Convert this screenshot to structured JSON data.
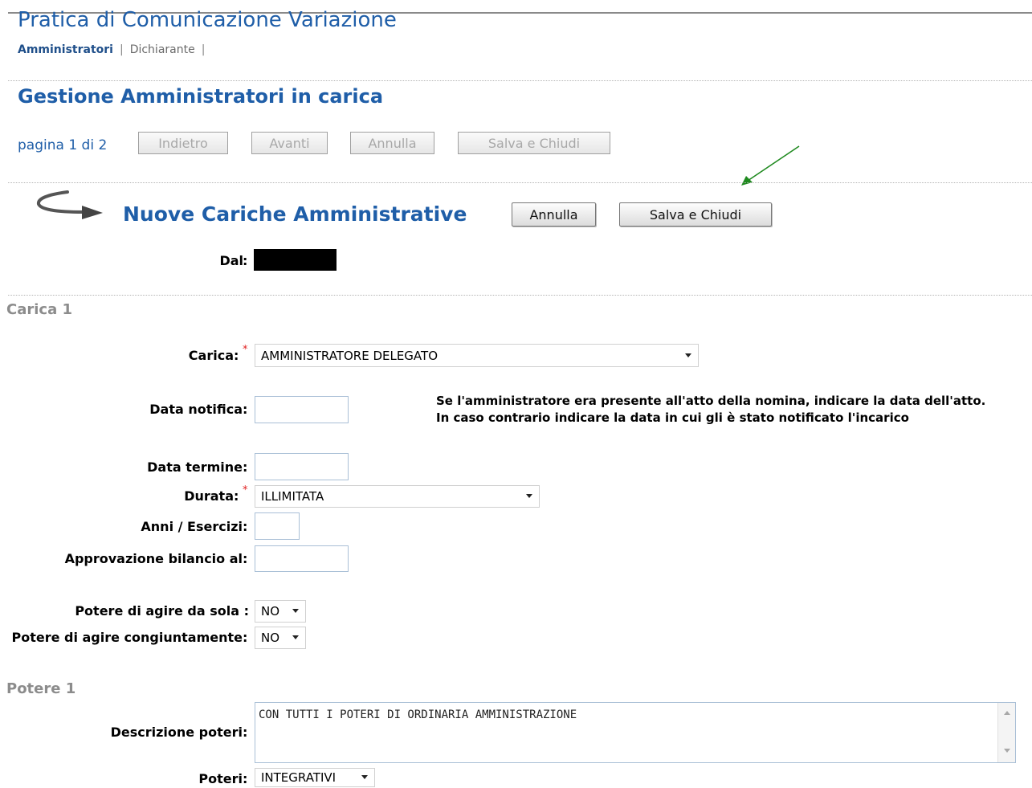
{
  "header": {
    "page_title": "Pratica di Comunicazione Variazione",
    "tabs": [
      {
        "label": "Amministratori",
        "active": true
      },
      {
        "label": "Dichiarante",
        "active": false
      }
    ],
    "tab_separator": "|"
  },
  "section": {
    "title": "Gestione Amministratori in carica",
    "pager": "pagina 1 di 2",
    "buttons": {
      "back": "Indietro",
      "next": "Avanti",
      "cancel": "Annulla",
      "save_close": "Salva e Chiudi"
    }
  },
  "new_roles": {
    "title": "Nuove Cariche Amministrative",
    "cancel_label": "Annulla",
    "save_close_label": "Salva e Chiudi",
    "dal_label": "Dal",
    "colon": ":",
    "accent_arrow_color": "#1f8a1f"
  },
  "carica": {
    "heading": "Carica 1",
    "fields": {
      "carica_label": "Carica",
      "carica_value": "AMMINISTRATORE DELEGATO",
      "data_notifica_label": "Data notifica",
      "data_notifica_value": "",
      "hint_line1": "Se l'amministratore era presente all'atto della nomina, indicare la data dell'atto.",
      "hint_line2": "In caso contrario indicare la data in cui gli è stato notificato l'incarico",
      "data_termine_label": "Data termine",
      "data_termine_value": "",
      "durata_label": "Durata",
      "durata_value": "ILLIMITATA",
      "anni_label": "Anni / Esercizi",
      "anni_value": "",
      "approvazione_label": "Approvazione bilancio al",
      "approvazione_value": "",
      "potere_sola_label": "Potere di agire da sola :",
      "potere_sola_value": "NO",
      "potere_congiunt_label": "Potere di agire congiuntamente",
      "potere_congiunt_value": "NO"
    },
    "required_marker": "*"
  },
  "potere": {
    "heading": "Potere 1",
    "descrizione_label": "Descrizione poteri",
    "descrizione_value": "CON TUTTI I POTERI DI ORDINARIA AMMINISTRAZIONE",
    "poteri_label": "Poteri",
    "poteri_value": "INTEGRATIVI"
  }
}
